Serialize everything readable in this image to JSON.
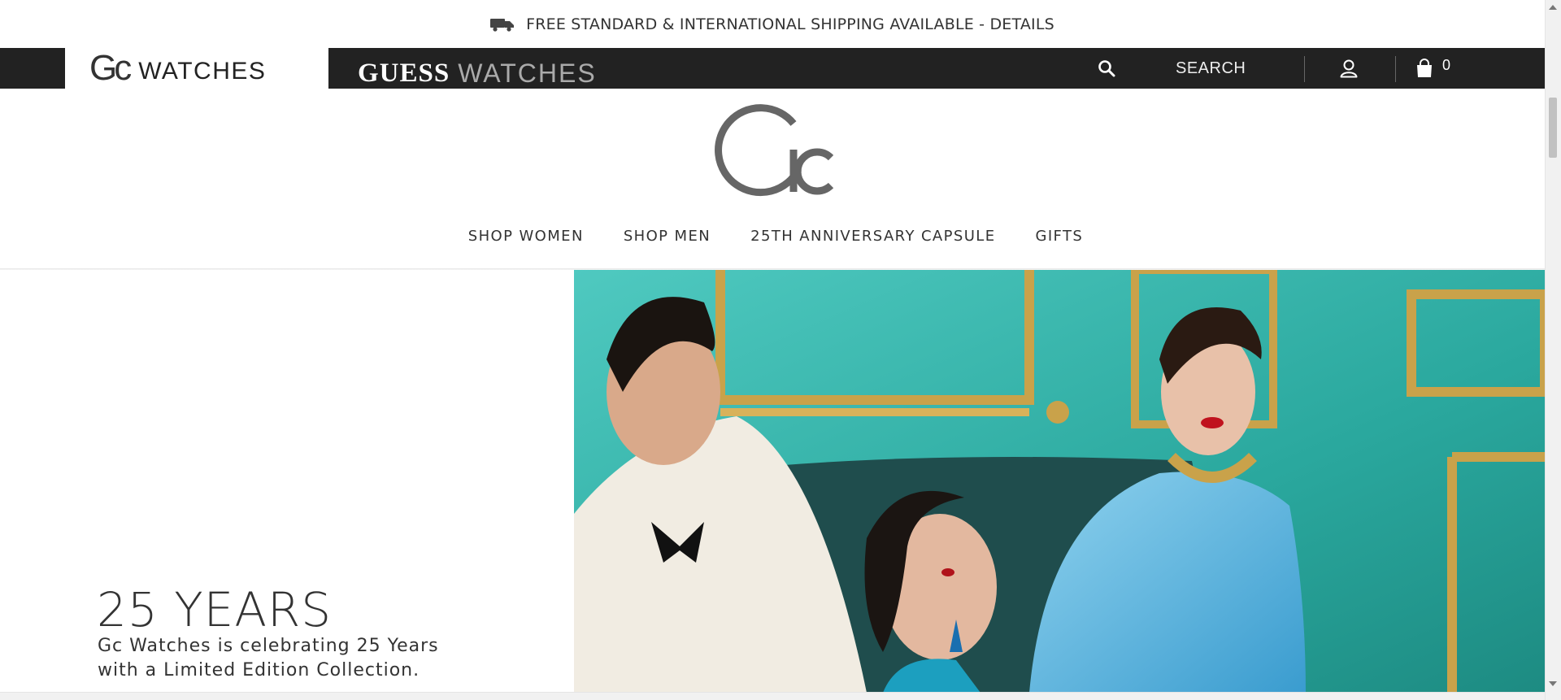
{
  "announcement": {
    "text": "FREE STANDARD & INTERNATIONAL SHIPPING AVAILABLE - DETAILS"
  },
  "brands": {
    "gc": {
      "mark": "Gc",
      "word": "WATCHES"
    },
    "guess": {
      "word1": "GUESS",
      "word2": "WATCHES"
    }
  },
  "utility": {
    "search_label": "SEARCH",
    "bag_count": "0"
  },
  "nav": {
    "items": [
      {
        "label": "SHOP WOMEN"
      },
      {
        "label": "SHOP MEN"
      },
      {
        "label": "25TH ANNIVERSARY CAPSULE"
      },
      {
        "label": "GIFTS"
      }
    ]
  },
  "hero": {
    "title": "25 YEARS",
    "subtitle": "Gc Watches is celebrating 25 Years with a Limited Edition Collection."
  },
  "colors": {
    "topbar": "#222222",
    "accent_teal": "#2fb3a8",
    "text": "#333333",
    "gold": "#c9a24a"
  },
  "icons": [
    "truck-icon",
    "search-icon",
    "account-icon",
    "shopping-bag-icon",
    "gc-logo"
  ]
}
